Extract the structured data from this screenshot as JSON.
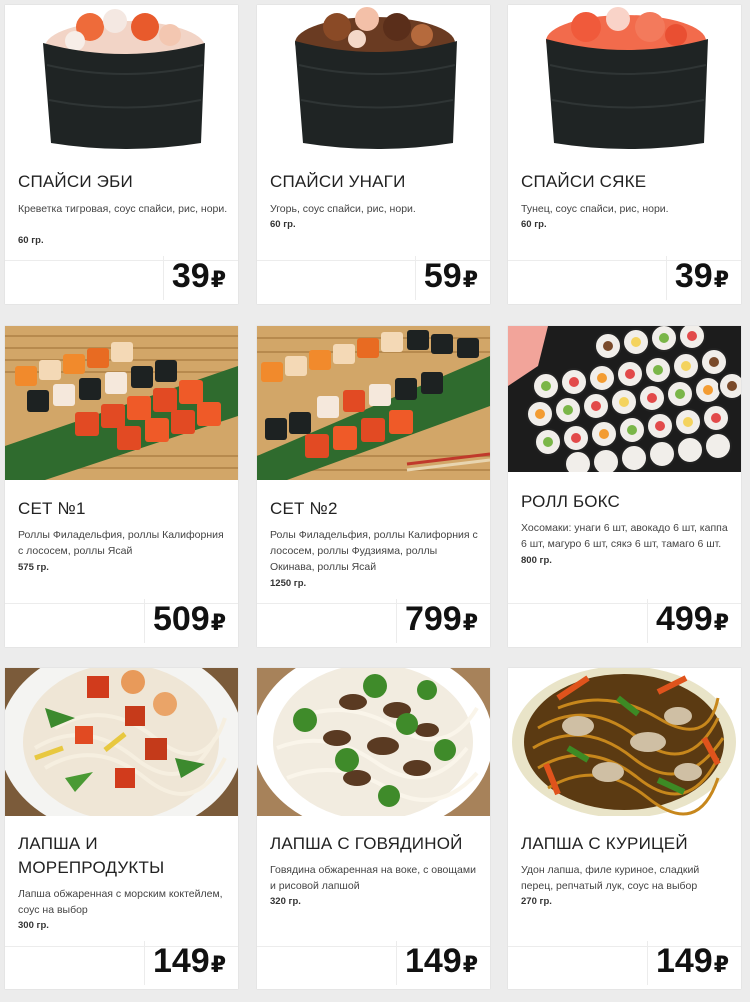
{
  "currency": "₽",
  "products": [
    {
      "title": "СПАЙСИ ЭБИ",
      "desc": "Креветка тигровая, соус спайси, рис, нори.",
      "weight": "60 гр.",
      "price": "39"
    },
    {
      "title": "СПАЙСИ УНАГИ",
      "desc": "Угорь, соус спайси, рис, нори.",
      "weight": "60 гр.",
      "price": "59"
    },
    {
      "title": "СПАЙСИ СЯКЕ",
      "desc": "Тунец, соус спайси, рис, нори.",
      "weight": "60 гр.",
      "price": "39"
    },
    {
      "title": "СЕТ №1",
      "desc": "Роллы Филадельфия, роллы Калифорния с лососем, роллы Ясай",
      "weight": "575 гр.",
      "price": "509"
    },
    {
      "title": "СЕТ №2",
      "desc": "Ролы Филадельфия, роллы Калифорния с лососем, роллы Фудзияма, роллы Окинава, роллы Ясай",
      "weight": "1250 гр.",
      "price": "799"
    },
    {
      "title": "РОЛЛ БОКС",
      "desc": "Хосомаки: унаги 6 шт, авокадо 6 шт, каппа 6 шт, магуро 6 шт, сякэ 6 шт, тамаго 6 шт.",
      "weight": "800 гр.",
      "price": "499"
    },
    {
      "title": "ЛАПША И МОРЕПРОДУКТЫ",
      "desc": "Лапша обжаренная с морским коктейлем, соус на выбор",
      "weight": "300 гр.",
      "price": "149"
    },
    {
      "title": "ЛАПША С ГОВЯДИНОЙ",
      "desc": "Говядина обжаренная на воке, с овощами и рисовой лапшой",
      "weight": "320 гр.",
      "price": "149"
    },
    {
      "title": "ЛАПША С КУРИЦЕЙ",
      "desc": "Удон лапша, филе куриное, сладкий перец, репчатый лук, соус на выбор",
      "weight": "270 гр.",
      "price": "149"
    }
  ]
}
